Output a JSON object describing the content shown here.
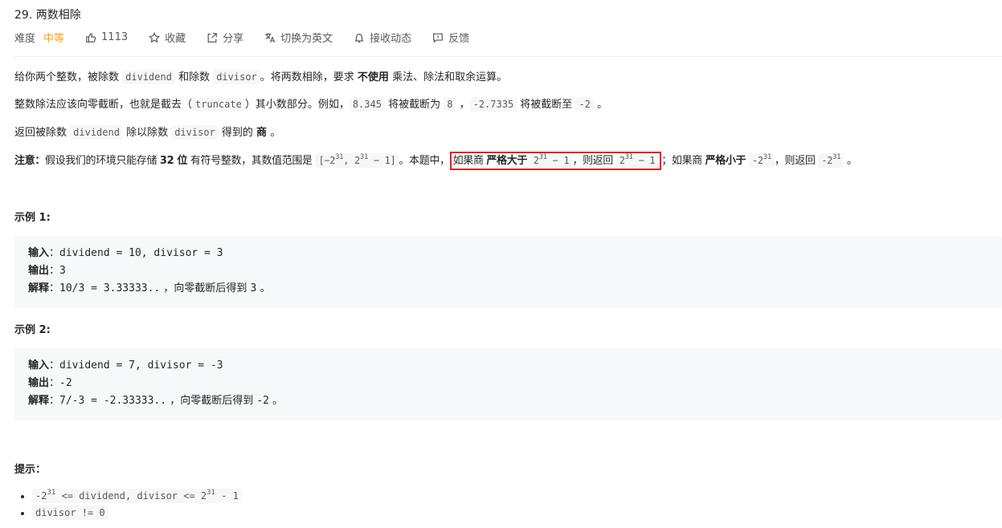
{
  "problem": {
    "title": "29. 两数相除"
  },
  "meta": {
    "difficulty_label": "难度",
    "difficulty_value": "中等",
    "likes": "1113",
    "favorite": "收藏",
    "share": "分享",
    "switch_lang": "切换为英文",
    "subscribe": "接收动态",
    "feedback": "反馈"
  },
  "desc": {
    "p1_a": "给你两个整数，被除数 ",
    "p1_code1": "dividend",
    "p1_b": " 和除数 ",
    "p1_code2": "divisor",
    "p1_c": "。将两数相除，要求 ",
    "p1_bold": "不使用",
    "p1_d": " 乘法、除法和取余运算。",
    "p2_a": "整数除法应该向零截断，也就是截去（",
    "p2_code1": "truncate",
    "p2_b": "）其小数部分。例如，",
    "p2_code2": "8.345",
    "p2_c": " 将被截断为 ",
    "p2_code3": "8",
    "p2_d": " ，",
    "p2_code4": "-2.7335",
    "p2_e": " 将被截断至 ",
    "p2_code5": "-2",
    "p2_f": " 。",
    "p3_a": "返回被除数 ",
    "p3_code1": "dividend",
    "p3_b": " 除以除数 ",
    "p3_code2": "divisor",
    "p3_c": " 得到的 ",
    "p3_bold": "商",
    "p3_d": " 。",
    "note_label": "注意：",
    "note_a": "假设我们的环境只能存储 ",
    "note_bold1": "32 位",
    "note_b": " 有符号整数，其数值范围是 ",
    "range_code_a": "[−2",
    "range_sup1": "31",
    "range_code_b": ",  2",
    "range_sup2": "31",
    "range_code_c": " − 1]",
    "note_c": "。本题中，",
    "hl_a": "如果商 ",
    "hl_bold": "严格大于",
    "hl_code1_a": "2",
    "hl_code1_sup": "31",
    "hl_code1_b": " − 1",
    "hl_b": "，则返回 ",
    "hl_code2_a": "2",
    "hl_code2_sup": "31",
    "hl_code2_b": " − 1",
    "note_d": "；如果商 ",
    "note_bold2": "严格小于",
    "neg_code_a": "-2",
    "neg_code_sup": "31",
    "note_e": "，则返回 ",
    "neg2_code_a": "-2",
    "neg2_code_sup": "31",
    "note_f": " 。"
  },
  "examples": [
    {
      "heading": "示例 1:",
      "input_label": "输入",
      "input_value": "dividend = 10, divisor = 3",
      "output_label": "输出",
      "output_value": "3",
      "explain_label": "解释",
      "explain_value": "10/3 = 3.33333..",
      "explain_text": " ，向零截断后得到 ",
      "explain_result": "3",
      "explain_end": " 。"
    },
    {
      "heading": "示例 2:",
      "input_label": "输入",
      "input_value": "dividend = 7, divisor = -3",
      "output_label": "输出",
      "output_value": "-2",
      "explain_label": "解释",
      "explain_value": "7/-3 = -2.33333..",
      "explain_text": " ，向零截断后得到 ",
      "explain_result": "-2",
      "explain_end": " 。"
    }
  ],
  "hints": {
    "heading": "提示：",
    "h1_a": "-2",
    "h1_sup1": "31",
    "h1_b": " <= dividend, divisor <= 2",
    "h1_sup2": "31",
    "h1_c": " - 1",
    "h2": "divisor != 0"
  },
  "colors": {
    "difficulty": "#ffa116",
    "highlight_border": "#e02020"
  },
  "icons": [
    "thumbs-up-icon",
    "star-icon",
    "share-icon",
    "translate-icon",
    "bell-icon",
    "feedback-icon"
  ]
}
